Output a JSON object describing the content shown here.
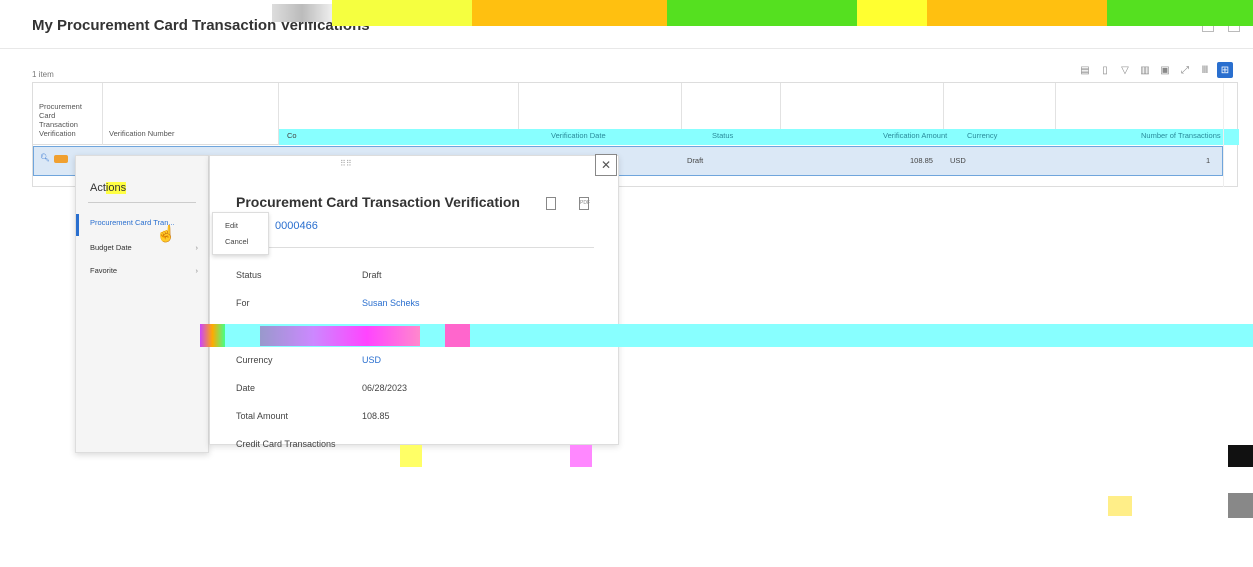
{
  "page": {
    "title": "My Procurement Card Transaction Verifications",
    "item_count": "1 item"
  },
  "columns": {
    "col1": "Procurement Card Transaction Verification",
    "col2": "Verification Number",
    "col3": "Co",
    "col4": "Verification Date",
    "col5": "Status",
    "col6": "Verification Amount",
    "col7": "Currency",
    "col8": "Number of Transactions"
  },
  "row": {
    "status": "Draft",
    "amount": "108.85",
    "currency": "USD",
    "transactions": "1"
  },
  "actions": {
    "title_prefix": "Act",
    "title_highlight": "ions",
    "items": [
      {
        "label": "Procurement Card Tran..."
      },
      {
        "label": "Budget Date"
      },
      {
        "label": "Favorite"
      }
    ]
  },
  "submenu": {
    "edit": "Edit",
    "cancel": "Cancel"
  },
  "detail": {
    "title": "Procurement Card Transaction Verification",
    "id": "0000466",
    "pdf_label": "PDF",
    "fields": {
      "status_label": "Status",
      "status_value": "Draft",
      "for_label": "For",
      "for_value": "Susan Scheks",
      "currency_label": "Currency",
      "currency_value": "USD",
      "date_label": "Date",
      "date_value": "06/28/2023",
      "total_label": "Total Amount",
      "total_value": "108.85",
      "cc_label": "Credit Card Transactions"
    }
  },
  "icons": {
    "toolbar": [
      "excel-icon",
      "pdf-icon",
      "filter-icon",
      "chart-icon",
      "columns-icon",
      "fullscreen-icon",
      "list-view-icon",
      "grid-view-icon"
    ]
  },
  "colors": {
    "accent": "#2a6fcf",
    "row_selected": "#dbe8f6"
  }
}
